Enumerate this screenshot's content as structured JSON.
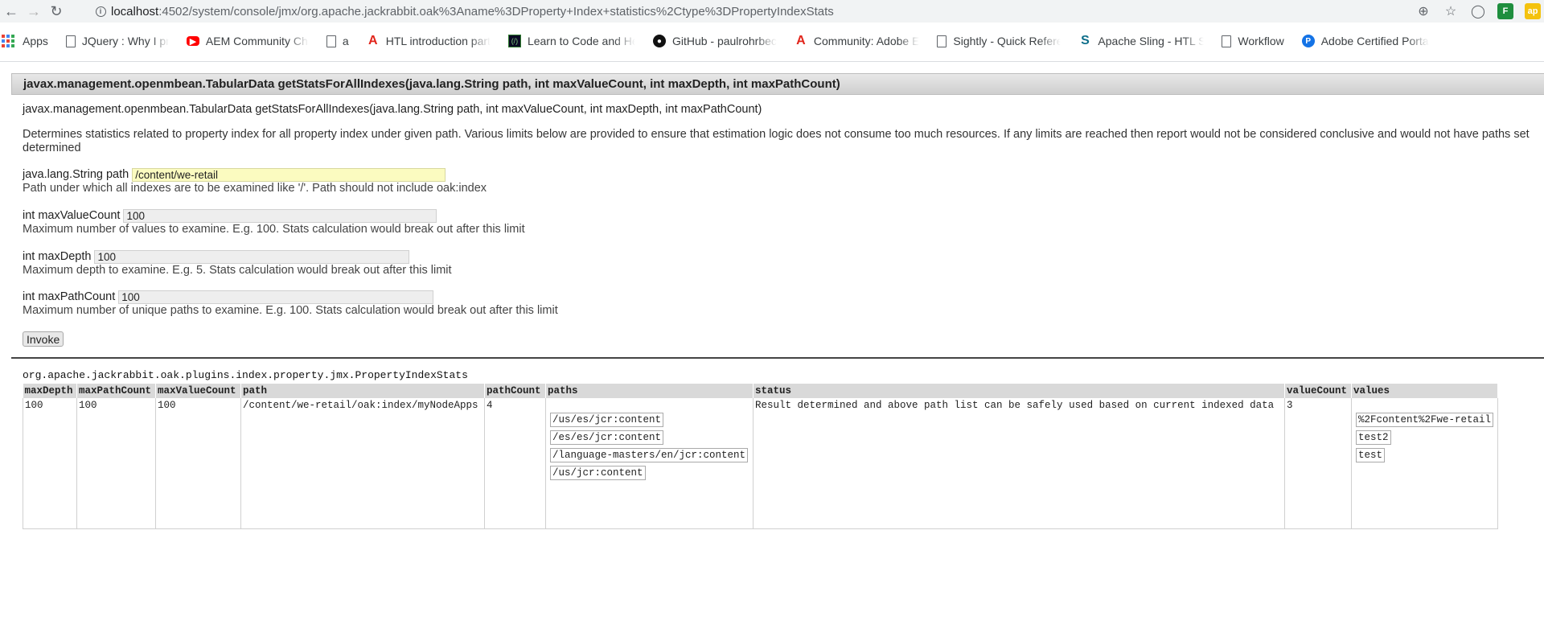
{
  "browser": {
    "url_host": "localhost",
    "url_rest": ":4502/system/console/jmx/org.apache.jackrabbit.oak%3Aname%3DProperty+Index+statistics%2Ctype%3DPropertyIndexStats",
    "bookmarks": [
      {
        "label": "Apps",
        "icon": "apps-grid-icon"
      },
      {
        "label": "JQuery : Why I prefer",
        "icon": "document-icon"
      },
      {
        "label": "AEM Community Cha",
        "icon": "youtube-icon"
      },
      {
        "label": "a",
        "icon": "document-icon"
      },
      {
        "label": "HTL introduction part",
        "icon": "adobe-icon"
      },
      {
        "label": "Learn to Code and He",
        "icon": "freecodecamp-icon"
      },
      {
        "label": "GitHub - paulrohrbec",
        "icon": "github-icon"
      },
      {
        "label": "Community: Adobe E",
        "icon": "adobe-icon"
      },
      {
        "label": "Sightly - Quick Refere",
        "icon": "document-icon"
      },
      {
        "label": "Apache Sling - HTL Sc",
        "icon": "sling-icon"
      },
      {
        "label": "Workflow",
        "icon": "document-icon"
      },
      {
        "label": "Adobe Certified Porta",
        "icon": "certified-icon"
      }
    ]
  },
  "operation": {
    "header": "javax.management.openmbean.TabularData getStatsForAllIndexes(java.lang.String path, int maxValueCount, int maxDepth, int maxPathCount)",
    "signature": "javax.management.openmbean.TabularData getStatsForAllIndexes(java.lang.String path, int maxValueCount, int maxDepth, int maxPathCount)",
    "description": "Determines statistics related to property index for all property index under given path. Various limits below are provided to ensure that estimation logic does not consume too much resources. If any limits are reached then report would not be considered conclusive and would not have paths set determined",
    "params": [
      {
        "label": "java.lang.String path",
        "value": "/content/we-retail",
        "hint": "Path under which all indexes are to be examined like '/'. Path should not include oak:index"
      },
      {
        "label": "int maxValueCount",
        "value": "100",
        "hint": "Maximum number of values to examine. E.g. 100. Stats calculation would break out after this limit"
      },
      {
        "label": "int maxDepth",
        "value": "100",
        "hint": "Maximum depth to examine. E.g. 5. Stats calculation would break out after this limit"
      },
      {
        "label": "int maxPathCount",
        "value": "100",
        "hint": "Maximum number of unique paths to examine. E.g. 100. Stats calculation would break out after this limit"
      }
    ],
    "invoke_label": "Invoke"
  },
  "result": {
    "title": "org.apache.jackrabbit.oak.plugins.index.property.jmx.PropertyIndexStats",
    "columns": [
      "maxDepth",
      "maxPathCount",
      "maxValueCount",
      "path",
      "pathCount",
      "paths",
      "status",
      "valueCount",
      "values"
    ],
    "row": {
      "maxDepth": "100",
      "maxPathCount": "100",
      "maxValueCount": "100",
      "path": "/content/we-retail/oak:index/myNodeApps",
      "pathCount": "4",
      "paths": [
        "/us/es/jcr:content",
        "/es/es/jcr:content",
        "/language-masters/en/jcr:content",
        "/us/jcr:content"
      ],
      "status": "Result determined and above path list can be safely used based on current indexed data",
      "valueCount": "3",
      "values": [
        "%2Fcontent%2Fwe-retail",
        "test2",
        "test"
      ]
    }
  }
}
